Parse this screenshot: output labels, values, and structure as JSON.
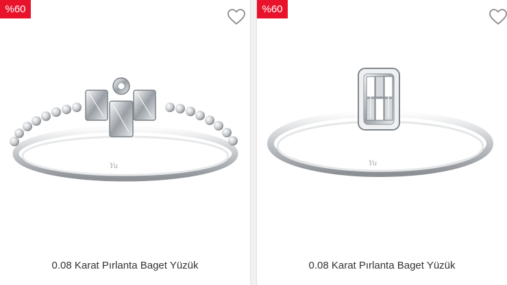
{
  "products": [
    {
      "badge": "%60",
      "name": "0.08 Karat Pırlanta Baget Yüzük",
      "favorite_icon": "heart-outline-icon",
      "image_alt": "ring-with-baguette-cluster-beaded-band"
    },
    {
      "badge": "%60",
      "name": "0.08 Karat Pırlanta Baget Yüzük",
      "favorite_icon": "heart-outline-icon",
      "image_alt": "ring-with-rectangular-baguette-top"
    }
  ],
  "colors": {
    "badge_bg": "#e8132b",
    "badge_text": "#ffffff",
    "title_text": "#333333",
    "divider": "#f1f1f1"
  }
}
